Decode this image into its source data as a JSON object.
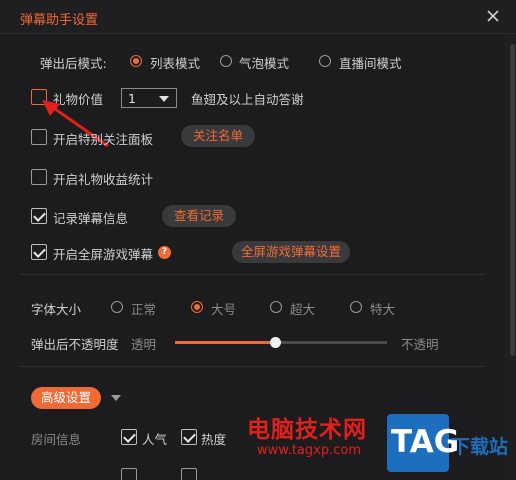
{
  "window": {
    "title": "弹幕助手设置"
  },
  "popup_mode": {
    "label": "弹出后模式:",
    "options": [
      {
        "label": "列表模式",
        "selected": true
      },
      {
        "label": "气泡模式",
        "selected": false
      },
      {
        "label": "直播间模式",
        "selected": false
      }
    ]
  },
  "gift_value": {
    "label": "礼物价值",
    "checked": false,
    "select_value": "1",
    "suffix": "鱼翅及以上自动答谢"
  },
  "special_follow": {
    "label": "开启特别关注面板",
    "checked": false,
    "button": "关注名单"
  },
  "gift_revenue": {
    "label": "开启礼物收益统计",
    "checked": false
  },
  "record_danmaku": {
    "label": "记录弹幕信息",
    "checked": true,
    "button": "查看记录"
  },
  "fullscreen_game": {
    "label": "开启全屏游戏弹幕",
    "checked": true,
    "help": "?",
    "button": "全屏游戏弹幕设置"
  },
  "font_size": {
    "label": "字体大小",
    "options": [
      {
        "label": "正常",
        "selected": false
      },
      {
        "label": "大号",
        "selected": true
      },
      {
        "label": "超大",
        "selected": false
      },
      {
        "label": "特大",
        "selected": false
      }
    ]
  },
  "opacity": {
    "label": "弹出后不透明度",
    "min_label": "透明",
    "max_label": "不透明",
    "value": 0.47
  },
  "advanced": {
    "button": "高级设置"
  },
  "room_info": {
    "label": "房间信息",
    "items": [
      {
        "label": "人气",
        "checked": true
      },
      {
        "label": "热度",
        "checked": true
      }
    ]
  },
  "watermark": {
    "site_name": "电脑技术网",
    "site_url": "www.tagxp.com",
    "logo_text": "TAG",
    "side_text": "下载站"
  },
  "colors": {
    "accent": "#f06a35",
    "background": "#1c1c1e",
    "watermark_red": "#e0201b",
    "tag_blue": "#1d6fbd"
  }
}
